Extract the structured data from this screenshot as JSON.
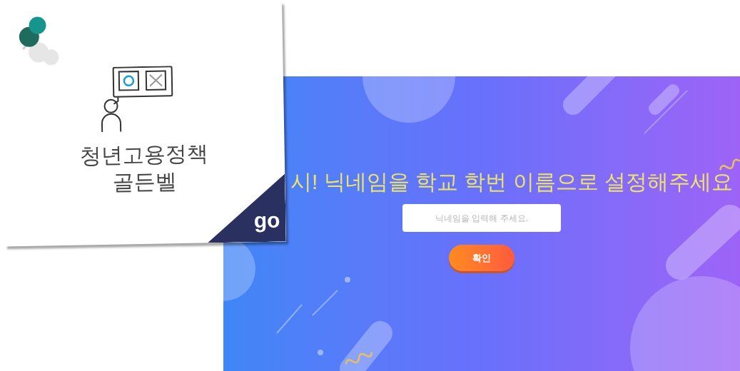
{
  "card": {
    "title_lines": [
      "청년고용정책",
      "골든벨"
    ],
    "corner_label": "go"
  },
  "page": {
    "headline": "시! 닉네임을 학교 학번 이름으로 설정해주세요",
    "nickname_field": {
      "placeholder": "닉네임을 입력해 주세요."
    },
    "confirm_button": {
      "label": "확인"
    }
  }
}
